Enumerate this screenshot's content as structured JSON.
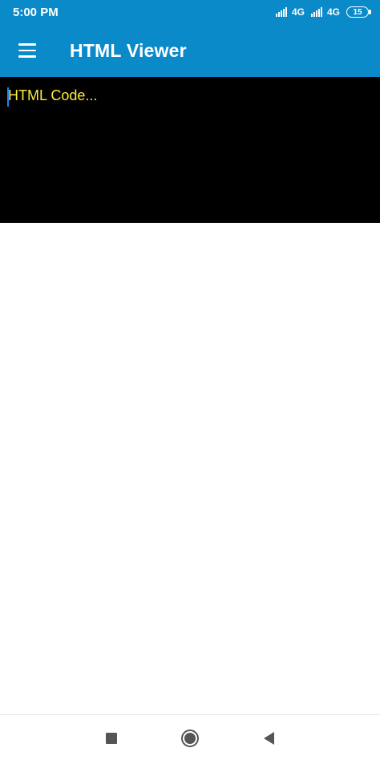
{
  "status_bar": {
    "time": "5:00 PM",
    "network_1": "4G",
    "network_2": "4G",
    "battery_level": "15"
  },
  "app_bar": {
    "title": "HTML Viewer",
    "menu_icon": "hamburger-menu-icon"
  },
  "editor": {
    "placeholder": "HTML Code...",
    "value": "",
    "background_color": "#000000",
    "text_color": "#ffeb3b"
  },
  "nav_bar": {
    "recents_icon": "square-recents-icon",
    "home_icon": "circle-home-icon",
    "back_icon": "triangle-back-icon"
  },
  "colors": {
    "primary": "#0a8ac9"
  }
}
